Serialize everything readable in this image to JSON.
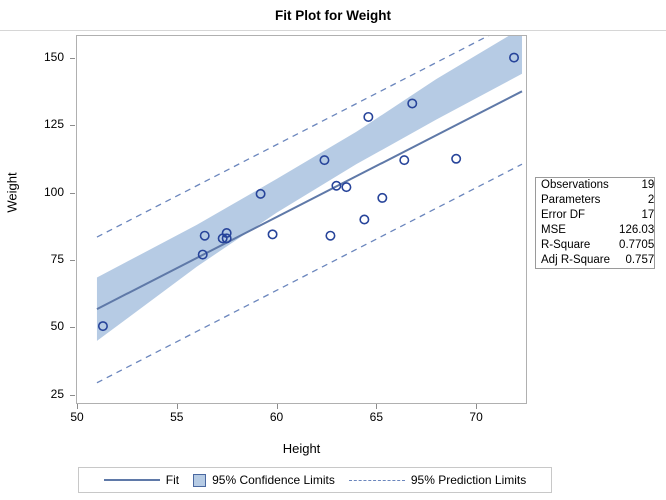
{
  "chart": {
    "title": "Fit Plot for Weight",
    "xlabel": "Height",
    "ylabel": "Weight"
  },
  "stats": {
    "rows": [
      {
        "label": "Observations",
        "value": "19"
      },
      {
        "label": "Parameters",
        "value": "2"
      },
      {
        "label": "Error DF",
        "value": "17"
      },
      {
        "label": "MSE",
        "value": "126.03"
      },
      {
        "label": "R-Square",
        "value": "0.7705"
      },
      {
        "label": "Adj R-Square",
        "value": "0.757"
      }
    ]
  },
  "legend": {
    "fit": "Fit",
    "confidence": "95% Confidence Limits",
    "prediction": "95% Prediction Limits"
  },
  "colors": {
    "fit_line": "#5f79a8",
    "band_fill": "#b6cbe4",
    "prediction_line": "#6b86bd",
    "marker_stroke": "#27449a",
    "axis": "#b0b0b0"
  },
  "chart_data": {
    "type": "scatter",
    "title": "Fit Plot for Weight",
    "xlabel": "Height",
    "ylabel": "Weight",
    "xlim": [
      50,
      72.5
    ],
    "ylim": [
      22,
      158
    ],
    "xticks": [
      50,
      55,
      60,
      65,
      70
    ],
    "yticks": [
      25,
      50,
      75,
      100,
      125,
      150
    ],
    "grid": false,
    "legend_position": "bottom",
    "points": [
      {
        "x": 51.3,
        "y": 50.5
      },
      {
        "x": 56.3,
        "y": 77.0
      },
      {
        "x": 56.4,
        "y": 84.0
      },
      {
        "x": 57.3,
        "y": 83.0
      },
      {
        "x": 57.5,
        "y": 85.0
      },
      {
        "x": 57.5,
        "y": 83.0
      },
      {
        "x": 59.2,
        "y": 99.5
      },
      {
        "x": 59.8,
        "y": 84.5
      },
      {
        "x": 62.4,
        "y": 112.0
      },
      {
        "x": 62.7,
        "y": 84.0
      },
      {
        "x": 63.0,
        "y": 102.5
      },
      {
        "x": 63.5,
        "y": 102.0
      },
      {
        "x": 64.4,
        "y": 90.0
      },
      {
        "x": 64.6,
        "y": 128.0
      },
      {
        "x": 65.3,
        "y": 98.0
      },
      {
        "x": 66.4,
        "y": 112.0
      },
      {
        "x": 66.8,
        "y": 133.0
      },
      {
        "x": 69.0,
        "y": 112.5
      },
      {
        "x": 71.9,
        "y": 150.0
      }
    ],
    "fit_line": {
      "x": [
        51.0,
        72.3
      ],
      "y": [
        56.8,
        137.5
      ]
    },
    "confidence_band": {
      "x": [
        51.0,
        56.0,
        60.0,
        64.0,
        68.0,
        72.3
      ],
      "upper": [
        68.5,
        88.0,
        105.0,
        122.5,
        142.0,
        161.0
      ],
      "lower": [
        45.0,
        72.5,
        92.5,
        110.5,
        127.0,
        144.0
      ]
    },
    "prediction_band": {
      "x": [
        51.0,
        72.3
      ],
      "upper": [
        83.5,
        164.5
      ],
      "lower": [
        29.5,
        110.5
      ]
    },
    "statistics": {
      "Observations": 19,
      "Parameters": 2,
      "Error DF": 17,
      "MSE": 126.03,
      "R-Square": 0.7705,
      "Adj R-Square": 0.757
    }
  }
}
